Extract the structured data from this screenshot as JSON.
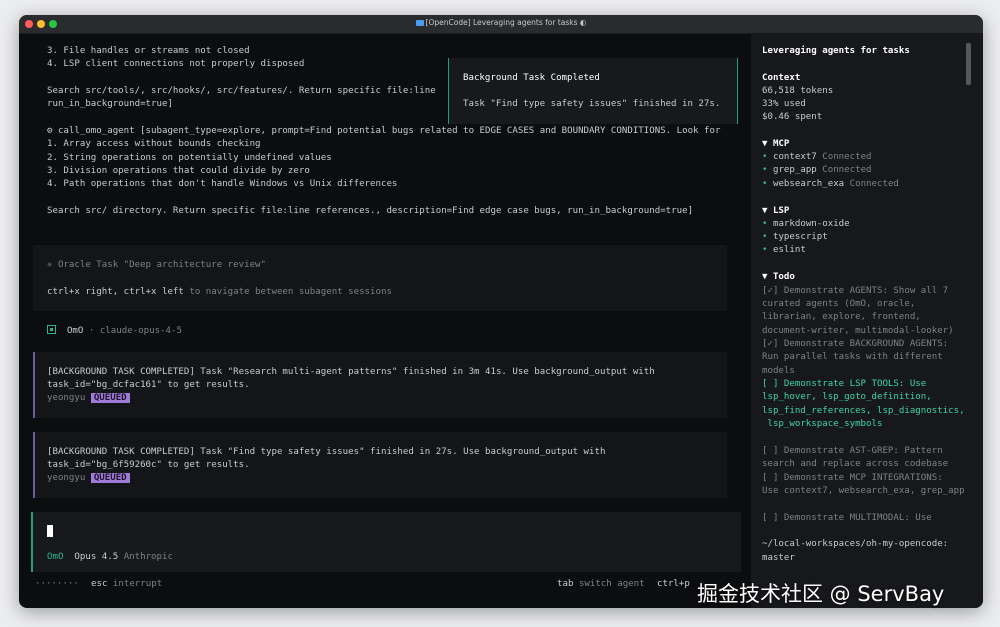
{
  "window": {
    "title": "[OpenCode] Leveraging agents for tasks ◐"
  },
  "log": {
    "lines1": [
      "3. File handles or streams not closed",
      "4. LSP client connections not properly disposed"
    ],
    "search1a": "Search src/tools/, src/hooks/, src/features/. Return specific file:line",
    "search1b": "run_in_background=true]",
    "call": "⚙ call_omo_agent [subagent_type=explore, prompt=Find potential bugs related to EDGE CASES and BOUNDARY CONDITIONS. Look for",
    "lines2": [
      "1. Array access without bounds checking",
      "2. String operations on potentially undefined values",
      "3. Division operations that could divide by zero",
      "4. Path operations that don't handle Windows vs Unix differences"
    ],
    "search2": "Search src/ directory. Return specific file:line references., description=Find edge case bugs, run_in_background=true]"
  },
  "oracle": {
    "title": "✳ Oracle Task \"Deep architecture review\"",
    "keys": "ctrl+x right, ctrl+x left",
    "hint": " to navigate between subagent sessions"
  },
  "agent_header": {
    "name": "OmO",
    "model": " · claude-opus-4-5"
  },
  "messages": [
    {
      "line1": "[BACKGROUND TASK COMPLETED] Task \"Research multi-agent patterns\" finished in 3m 41s. Use background_output with",
      "line2": "task_id=\"bg_dcfac161\" to get results.",
      "user": "yeongyu",
      "badge": "QUEUED"
    },
    {
      "line1": "[BACKGROUND TASK COMPLETED] Task \"Find type safety issues\" finished in 27s. Use background_output with",
      "line2": "task_id=\"bg_6f59260c\" to get results.",
      "user": "yeongyu",
      "badge": "QUEUED"
    }
  ],
  "toast": {
    "title": "Background Task Completed",
    "body": "Task \"Find type safety issues\" finished in 27s."
  },
  "input": {
    "agent": "OmO",
    "model": "Opus 4.5",
    "provider": "Anthropic"
  },
  "statusbar": {
    "dots": "········",
    "esc_key": "esc",
    "esc_label": " interrupt",
    "tab_key": "tab",
    "tab_label": " switch agent",
    "ctrlp_key": "ctrl+p",
    "partial": "16"
  },
  "sidebar": {
    "title": "Leveraging agents for tasks",
    "context_label": "Context",
    "tokens": "66,518 tokens",
    "used": "33% used",
    "spent": "$0.46 spent",
    "mcp_label": "▼ MCP",
    "mcp": [
      {
        "name": "context7",
        "status": " Connected"
      },
      {
        "name": "grep_app",
        "status": " Connected"
      },
      {
        "name": "websearch_exa",
        "status": " Connected"
      }
    ],
    "lsp_label": "▼ LSP",
    "lsp": [
      "markdown-oxide",
      "typescript",
      "eslint"
    ],
    "todo_label": "▼ Todo",
    "todo": [
      "[✓] Demonstrate AGENTS: Show all 7",
      "curated agents (OmO, oracle,",
      "librarian, explore, frontend,",
      "document-writer, multimodal-looker)",
      "[✓] Demonstrate BACKGROUND AGENTS:",
      "Run parallel tasks with different",
      "models",
      "[ ] Demonstrate LSP TOOLS: Use",
      "lsp_hover, lsp_goto_definition,",
      "lsp_find_references, lsp_diagnostics,",
      " lsp_workspace_symbols",
      "[ ] Demonstrate AST-GREP: Pattern",
      "search and replace across codebase",
      "[ ] Demonstrate MCP INTEGRATIONS:",
      "Use context7, websearch_exa, grep_app",
      "[ ] Demonstrate MULTIMODAL: Use"
    ],
    "path": "~/local-workspaces/oh-my-opencode:",
    "branch": "master"
  },
  "watermark": "掘金技术社区 @ ServBay",
  "colors": {
    "accent": "#1f9f7d",
    "badge": "#a07ad8",
    "model": "#2fb58c"
  }
}
